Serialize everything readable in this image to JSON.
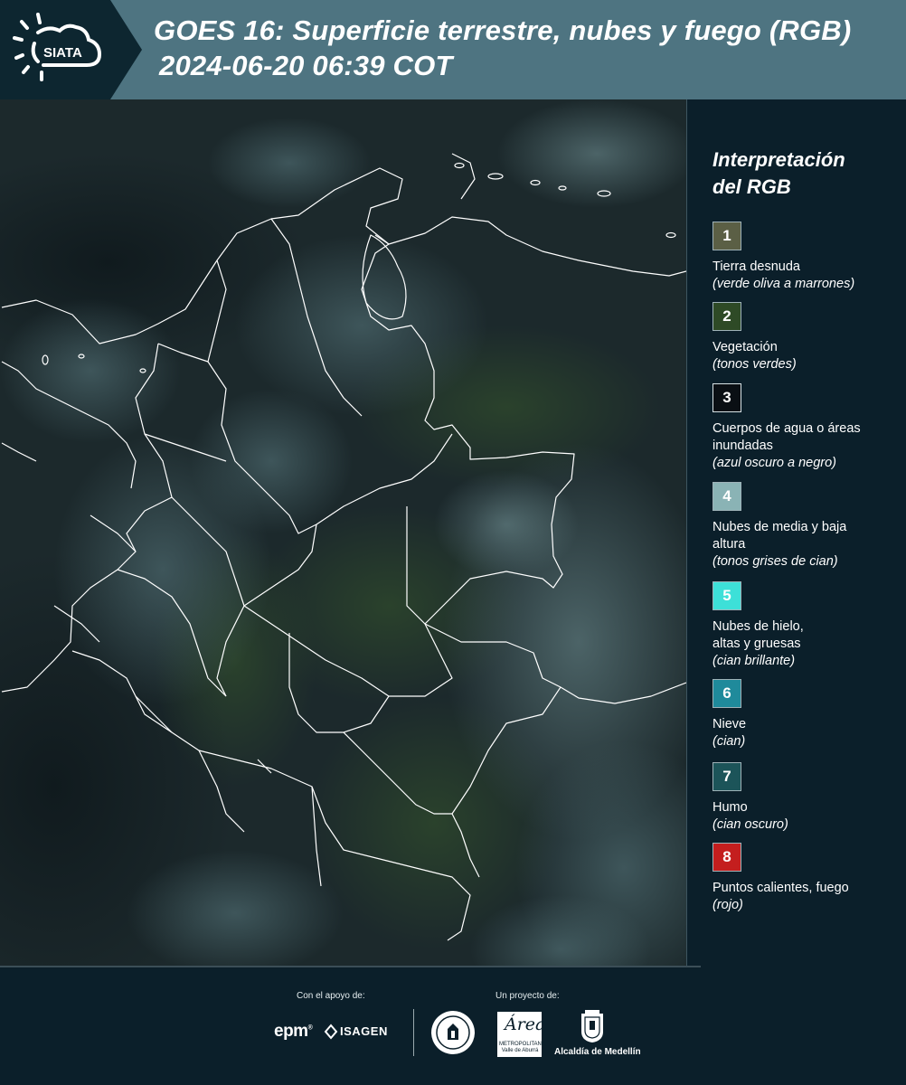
{
  "header": {
    "logo_text": "SIATA",
    "title_line1": "GOES 16: Superficie terrestre, nubes y fuego (RGB)",
    "title_line2": "2024-06-20 06:39 COT"
  },
  "map": {
    "icon": "satellite-map",
    "description_hidden": ""
  },
  "legend": {
    "title_line1": "Interpretación",
    "title_line2": "del RGB",
    "items": [
      {
        "num": "1",
        "label": "Tierra desnuda",
        "desc": "(verde oliva a marrones)",
        "color": "#5b5f45"
      },
      {
        "num": "2",
        "label": "Vegetación",
        "desc": "(tonos verdes)",
        "color": "#2e4a26"
      },
      {
        "num": "3",
        "label": "Cuerpos de agua o áreas inundadas",
        "desc": "(azul oscuro a negro)",
        "color": "#0a0f14"
      },
      {
        "num": "4",
        "label": "Nubes de media y baja altura",
        "desc": "(tonos grises de cian)",
        "color": "#8ab3b5"
      },
      {
        "num": "5",
        "label": "Nubes de hielo, altas y gruesas",
        "desc": "(cian brillante)",
        "color": "#3de0d8"
      },
      {
        "num": "6",
        "label": "Nieve",
        "desc": "(cian)",
        "color": "#1f8a9b"
      },
      {
        "num": "7",
        "label": "Humo",
        "desc": "(cian oscuro)",
        "color": "#1c5459"
      },
      {
        "num": "8",
        "label": "Puntos calientes, fuego",
        "desc": "(rojo)",
        "color": "#c41e1e"
      }
    ]
  },
  "footer": {
    "support_label": "Con el apoyo de:",
    "project_label": "Un proyecto de:",
    "epm": "epm",
    "isagen": "ISAGEN",
    "area_script": "Área",
    "area_text": "METROPOLITANA Valle de Aburrá",
    "alcaldia": "Alcaldía de Medellín"
  }
}
